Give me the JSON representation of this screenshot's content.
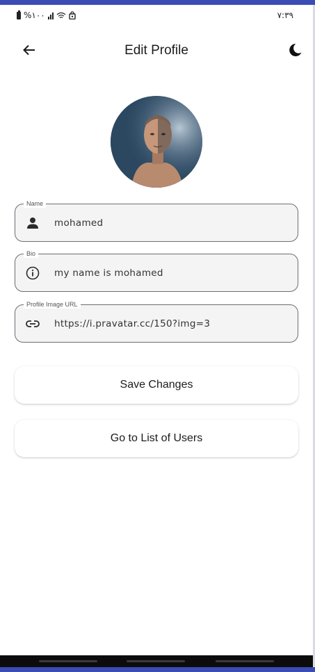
{
  "status_bar": {
    "battery_text": "%۱۰۰",
    "time": "۷:۳۹",
    "icons": [
      "battery-icon",
      "signal-icon",
      "wifi-icon",
      "lock-icon"
    ]
  },
  "app_bar": {
    "title": "Edit Profile",
    "back_icon": "arrow-back-icon",
    "theme_icon": "dark-mode-moon-icon"
  },
  "profile": {
    "avatar": "profile-photo"
  },
  "form": {
    "name": {
      "label": "Name",
      "value": "mohamed",
      "icon": "person-icon"
    },
    "bio": {
      "label": "Bio",
      "value": "my name is mohamed",
      "icon": "info-icon"
    },
    "image_url": {
      "label": "Profile Image URL",
      "value": "https://i.pravatar.cc/150?img=3",
      "icon": "link-icon"
    }
  },
  "actions": {
    "save_label": "Save Changes",
    "list_users_label": "Go to List of Users"
  },
  "colors": {
    "frame_accent": "#3b4cb5",
    "field_border": "#6f6b73",
    "field_fill": "#f4f4f4",
    "text": "#1c1b1f"
  }
}
